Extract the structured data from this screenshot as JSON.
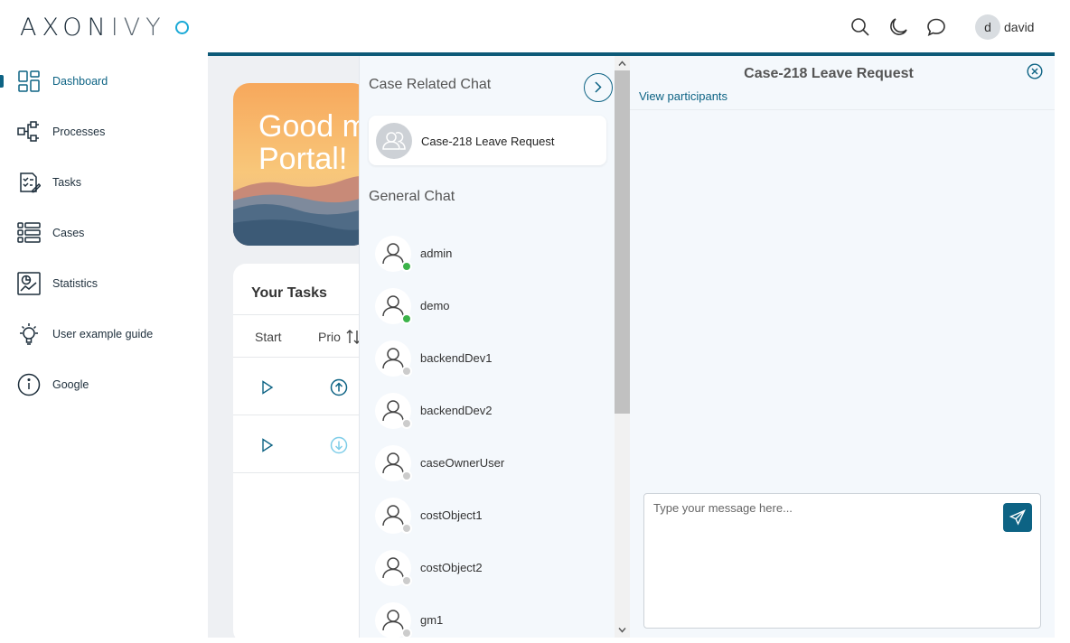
{
  "app": {
    "logo_main": "AXON",
    "logo_thin": "IVY"
  },
  "sidebar": {
    "items": [
      {
        "label": "Dashboard",
        "icon": "dashboard-icon"
      },
      {
        "label": "Processes",
        "icon": "processes-icon"
      },
      {
        "label": "Tasks",
        "icon": "tasks-icon"
      },
      {
        "label": "Cases",
        "icon": "cases-icon"
      },
      {
        "label": "Statistics",
        "icon": "statistics-icon"
      },
      {
        "label": "User example guide",
        "icon": "lightbulb-icon"
      },
      {
        "label": "Google",
        "icon": "info-icon"
      }
    ],
    "active": "Dashboard"
  },
  "topbar": {
    "user_initial": "d",
    "username": "david",
    "icons": [
      "search-icon",
      "moon-icon",
      "chat-icon"
    ]
  },
  "dashboard": {
    "welcome_line1": "Good m",
    "welcome_line2": "Portal!",
    "tasks_title": "Your Tasks",
    "col_start": "Start",
    "col_prio": "Prio"
  },
  "chat_list": {
    "case_section_title": "Case Related Chat",
    "case_chat": "Case-218 Leave Request",
    "general_section_title": "General Chat",
    "users": [
      {
        "name": "admin",
        "status": "online"
      },
      {
        "name": "demo",
        "status": "online"
      },
      {
        "name": "backendDev1",
        "status": "offline"
      },
      {
        "name": "backendDev2",
        "status": "offline"
      },
      {
        "name": "caseOwnerUser",
        "status": "offline"
      },
      {
        "name": "costObject1",
        "status": "offline"
      },
      {
        "name": "costObject2",
        "status": "offline"
      },
      {
        "name": "gm1",
        "status": "offline"
      }
    ]
  },
  "chat_window": {
    "title": "Case-218 Leave Request",
    "participants_link": "View participants",
    "input_placeholder": "Type your message here..."
  },
  "colors": {
    "accent": "#0d6384",
    "online": "#3cb34a",
    "offline": "#cccccc",
    "logo_dot": "#1aa9d6"
  }
}
